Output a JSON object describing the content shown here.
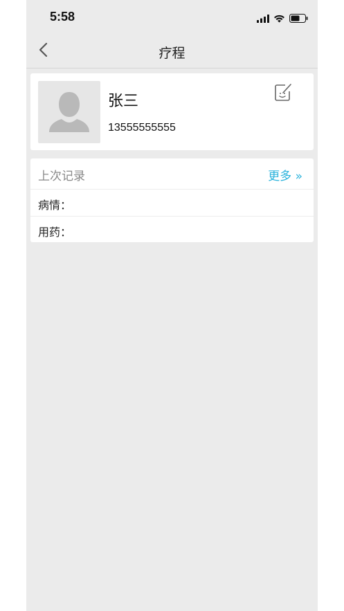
{
  "status_bar": {
    "time": "5:58"
  },
  "nav": {
    "title": "疗程"
  },
  "profile": {
    "name": "张三",
    "phone": "13555555555"
  },
  "last_record": {
    "title": "上次记录",
    "more_label": "更多 »",
    "rows": [
      {
        "label": "病情：",
        "value": ""
      },
      {
        "label": "用药：",
        "value": ""
      }
    ]
  },
  "colors": {
    "accent": "#2bb3dc",
    "background": "#ebebeb",
    "card": "#ffffff"
  }
}
